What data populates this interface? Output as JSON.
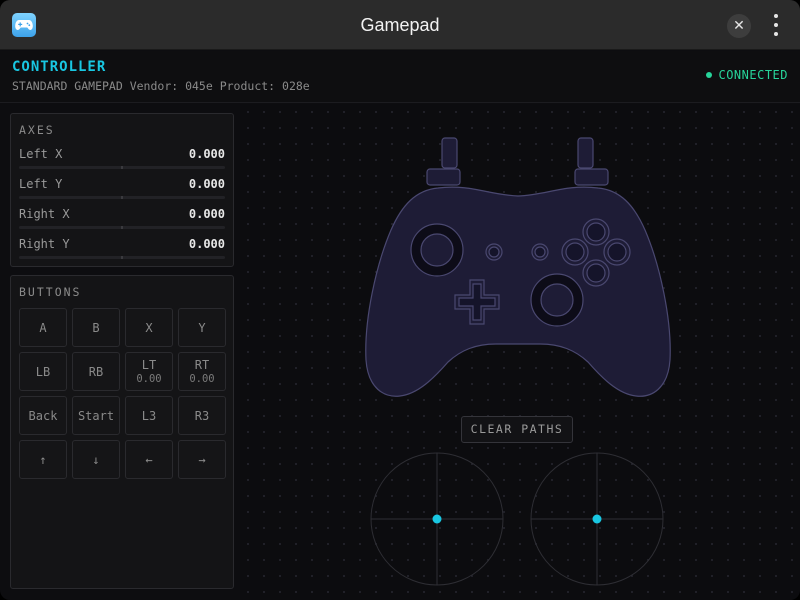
{
  "window": {
    "title": "Gamepad",
    "close_glyph": "✕",
    "app_icon": "gamepad-icon",
    "menu_icon": "more-vertical-icon"
  },
  "header": {
    "title": "CONTROLLER",
    "subtitle": "STANDARD GAMEPAD Vendor: 045e Product: 028e",
    "status": "CONNECTED",
    "status_color": "#27d49a",
    "accent_color": "#19c7e2"
  },
  "axes": {
    "title": "AXES",
    "items": [
      {
        "name": "Left X",
        "value": "0.000"
      },
      {
        "name": "Left Y",
        "value": "0.000"
      },
      {
        "name": "Right X",
        "value": "0.000"
      },
      {
        "name": "Right Y",
        "value": "0.000"
      }
    ]
  },
  "buttons": {
    "title": "BUTTONS",
    "items": [
      {
        "label": "A",
        "sub": ""
      },
      {
        "label": "B",
        "sub": ""
      },
      {
        "label": "X",
        "sub": ""
      },
      {
        "label": "Y",
        "sub": ""
      },
      {
        "label": "LB",
        "sub": ""
      },
      {
        "label": "RB",
        "sub": ""
      },
      {
        "label": "LT",
        "sub": "0.00"
      },
      {
        "label": "RT",
        "sub": "0.00"
      },
      {
        "label": "Back",
        "sub": ""
      },
      {
        "label": "Start",
        "sub": ""
      },
      {
        "label": "L3",
        "sub": ""
      },
      {
        "label": "R3",
        "sub": ""
      },
      {
        "label": "↑",
        "sub": ""
      },
      {
        "label": "↓",
        "sub": ""
      },
      {
        "label": "←",
        "sub": ""
      },
      {
        "label": "→",
        "sub": ""
      }
    ]
  },
  "visualizer": {
    "clear_label": "CLEAR PATHS",
    "controller_fill": "#1e1c36",
    "controller_stroke": "#4a4870",
    "stick_dot_color": "#19c7e2",
    "left_stick": {
      "x": 0.0,
      "y": 0.0
    },
    "right_stick": {
      "x": 0.0,
      "y": 0.0
    }
  }
}
